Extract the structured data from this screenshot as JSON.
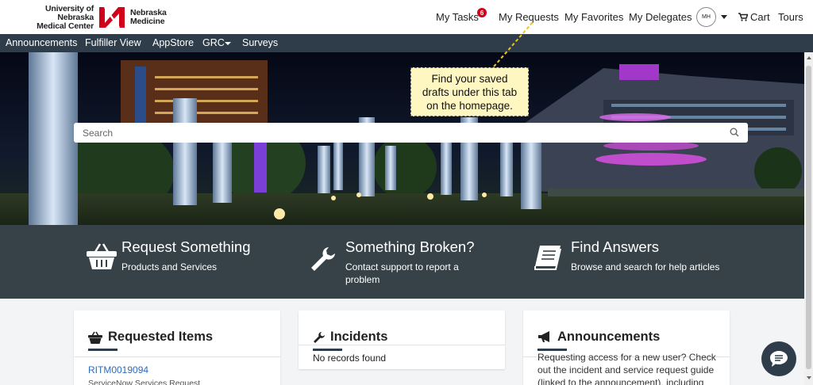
{
  "brand": {
    "org_line1": "University of Nebraska",
    "org_line2": "Medical Center",
    "partner_line1": "Nebraska",
    "partner_line2": "Medicine",
    "brand_red": "#d0021b"
  },
  "topnav": {
    "my_tasks": "My Tasks",
    "tasks_count": "6",
    "my_requests": "My Requests",
    "my_favorites": "My Favorites",
    "my_delegates": "My Delegates",
    "avatar_initials": "MH",
    "cart": "Cart",
    "tours": "Tours"
  },
  "subnav": {
    "announcements": "Announcements",
    "fulfiller_view": "Fulfiller View",
    "appstore": "AppStore",
    "grc": "GRC",
    "surveys": "Surveys"
  },
  "search": {
    "placeholder": "Search"
  },
  "callout": {
    "line1": "Find your saved",
    "line2": "drafts under this tab",
    "line3": "on the homepage."
  },
  "actions": [
    {
      "title": "Request Something",
      "desc1": "Products and Services",
      "desc2": "",
      "icon": "basket-icon"
    },
    {
      "title": "Something Broken?",
      "desc1": "Contact support to report a",
      "desc2": "problem",
      "icon": "wrench-icon"
    },
    {
      "title": "Find Answers",
      "desc1": "Browse and search for help articles",
      "desc2": "",
      "icon": "book-icon"
    }
  ],
  "cards": {
    "requested": {
      "title": "Requested Items",
      "item_number": "RITM0019094",
      "item_desc": "ServiceNow Services Request"
    },
    "incidents": {
      "title": "Incidents",
      "empty": "No records found"
    },
    "announcements": {
      "title": "Announcements",
      "line1": "Requesting access for a new user? Check",
      "line2": "out the incident and service request guide",
      "line3": "(linked to the announcement), including"
    }
  },
  "colors": {
    "nav_dark": "#2e3d49",
    "band": "#374248",
    "link": "#2a6bbf",
    "callout_bg": "#fff7c2"
  }
}
